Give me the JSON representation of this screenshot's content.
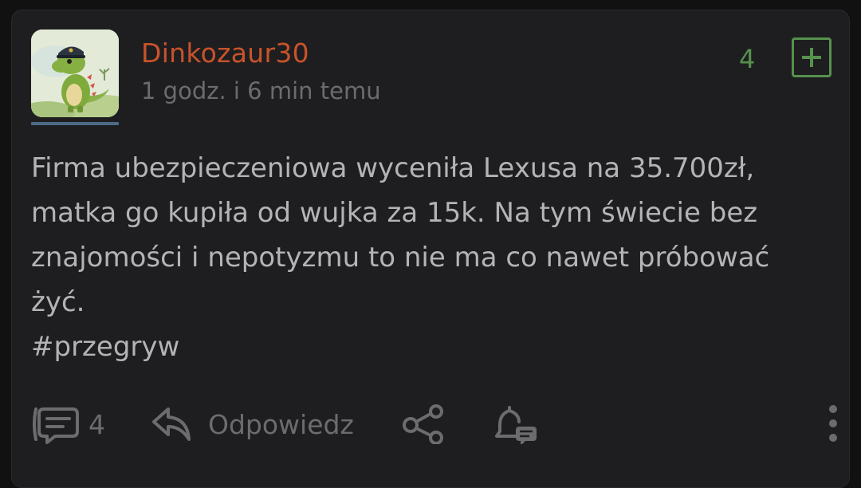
{
  "post": {
    "author": "Dinkozaur30",
    "time": "1 godz. i 6 min temu",
    "votes": "4",
    "body_lines": [
      "Firma ubezpieczeniowa wyceniła Lexusa na 35.700zł,",
      "matka go kupiła od wujka za 15k. Na tym świecie bez",
      "znajomości i nepotyzmu to nie ma co nawet próbować",
      "żyć.",
      "#przegryw"
    ]
  },
  "actions": {
    "comments_count": "4",
    "reply_label": "Odpowiedz",
    "icons": [
      "comments-icon",
      "reply-icon",
      "share-icon",
      "notify-icon",
      "more-icon"
    ]
  },
  "colors": {
    "background": "#1e1e20",
    "author": "#c9532a",
    "vote_accent": "#57914e",
    "muted": "#6c6c6e",
    "body": "#b4b4b6"
  }
}
